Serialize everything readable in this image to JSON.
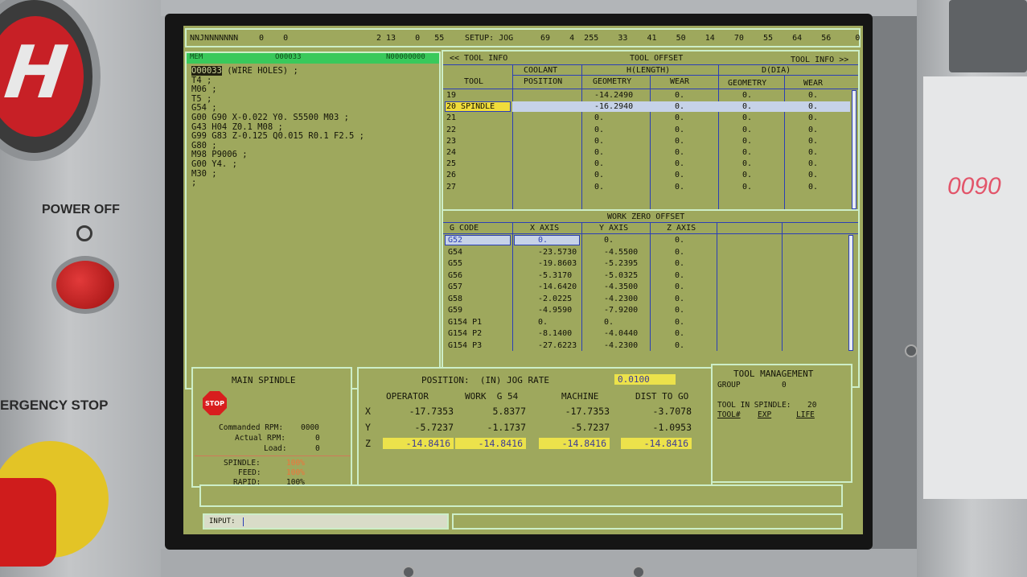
{
  "machine": {
    "power_off_label": "POWER OFF",
    "estop_label": "ERGENCY STOP",
    "sticker_text": "0090"
  },
  "status_bar": {
    "program_code": "NNJNNNNNNN",
    "vals_left": "0    0",
    "vals_mid": "2 13    0   55",
    "setup_label": "SETUP: JOG",
    "vals_right": "69    4  255    33    41    50    14    70    55    64    56     0     0"
  },
  "program": {
    "head_left": "MEM",
    "head_mid": "O00033",
    "head_right": "N00000000",
    "lines": [
      "O00033 (WIRE HOLES) ;",
      "T4 ;",
      "M06 ;",
      "T5 ;",
      "G54 ;",
      "G00 G90 X-0.022 Y0. S5500 M03 ;",
      "G43 H04 Z0.1 M08 ;",
      "G99 G83 Z-0.125 Q0.015 R0.1 F2.5 ;",
      "G80 ;",
      "M98 P9006 ;",
      "G00 Y4. ;",
      "M30 ;",
      ";"
    ]
  },
  "tool_offset": {
    "nav_left": "<< TOOL INFO",
    "title": "TOOL OFFSET",
    "nav_right": "TOOL INFO >>",
    "col_coolant": "COOLANT",
    "col_position": "POSITION",
    "col_tool": "TOOL",
    "col_hlength": "H(LENGTH)",
    "col_ddia": "D(DIA)",
    "col_geometry": "GEOMETRY",
    "col_wear": "WEAR",
    "rows": [
      {
        "tool": "19",
        "h_geo": "-14.2490",
        "h_wear": "0.",
        "d_geo": "0.",
        "d_wear": "0."
      },
      {
        "tool": "20 SPINDLE",
        "h_geo": "-16.2940",
        "h_wear": "0.",
        "d_geo": "0.",
        "d_wear": "0."
      },
      {
        "tool": "21",
        "h_geo": "0.",
        "h_wear": "0.",
        "d_geo": "0.",
        "d_wear": "0."
      },
      {
        "tool": "22",
        "h_geo": "0.",
        "h_wear": "0.",
        "d_geo": "0.",
        "d_wear": "0."
      },
      {
        "tool": "23",
        "h_geo": "0.",
        "h_wear": "0.",
        "d_geo": "0.",
        "d_wear": "0."
      },
      {
        "tool": "24",
        "h_geo": "0.",
        "h_wear": "0.",
        "d_geo": "0.",
        "d_wear": "0."
      },
      {
        "tool": "25",
        "h_geo": "0.",
        "h_wear": "0.",
        "d_geo": "0.",
        "d_wear": "0."
      },
      {
        "tool": "26",
        "h_geo": "0.",
        "h_wear": "0.",
        "d_geo": "0.",
        "d_wear": "0."
      },
      {
        "tool": "27",
        "h_geo": "0.",
        "h_wear": "0.",
        "d_geo": "0.",
        "d_wear": "0."
      }
    ]
  },
  "work_zero": {
    "title": "WORK ZERO OFFSET",
    "col_gcode": "G CODE",
    "col_x": "X AXIS",
    "col_y": "Y AXIS",
    "col_z": "Z AXIS",
    "rows": [
      {
        "g": "G52",
        "x": "0.",
        "y": "0.",
        "z": "0."
      },
      {
        "g": "G54",
        "x": "-23.5730",
        "y": "-4.5500",
        "z": "0."
      },
      {
        "g": "G55",
        "x": "-19.8603",
        "y": "-5.2395",
        "z": "0."
      },
      {
        "g": "G56",
        "x": "-5.3170",
        "y": "-5.0325",
        "z": "0."
      },
      {
        "g": "G57",
        "x": "-14.6420",
        "y": "-4.3500",
        "z": "0."
      },
      {
        "g": "G58",
        "x": "-2.0225",
        "y": "-4.2300",
        "z": "0."
      },
      {
        "g": "G59",
        "x": "-4.9590",
        "y": "-7.9200",
        "z": "0."
      },
      {
        "g": "G154 P1",
        "x": "0.",
        "y": "0.",
        "z": "0."
      },
      {
        "g": "G154 P2",
        "x": "-8.1400",
        "y": "-4.0440",
        "z": "0."
      },
      {
        "g": "G154 P3",
        "x": "-27.6223",
        "y": "-4.2300",
        "z": "0."
      }
    ]
  },
  "spindle": {
    "title": "MAIN SPINDLE",
    "stop_label": "STOP",
    "commanded_label": "Commanded RPM:",
    "commanded_val": "0000",
    "actual_label": "Actual RPM:",
    "actual_val": "0",
    "load_label": "Load:",
    "load_val": "0",
    "spindle_label": "SPINDLE:",
    "spindle_val": "100%",
    "feed_label": "FEED:",
    "feed_val": "100%",
    "rapid_label": "RAPID:",
    "rapid_val": "100%"
  },
  "position": {
    "title": "POSITION:  (IN) JOG RATE",
    "jog_rate": "0.0100",
    "col_operator": "OPERATOR",
    "col_work": "WORK  G 54",
    "col_machine": "MACHINE",
    "col_dist": "DIST TO GO",
    "rows": [
      {
        "axis": "X",
        "operator": "-17.7353",
        "work": "5.8377",
        "machine": "-17.7353",
        "dist": "-3.7078"
      },
      {
        "axis": "Y",
        "operator": "-5.7237",
        "work": "-1.1737",
        "machine": "-5.7237",
        "dist": "-1.0953"
      },
      {
        "axis": "Z",
        "operator": "-14.8416",
        "work": "-14.8416",
        "machine": "-14.8416",
        "dist": "-14.8416"
      }
    ]
  },
  "tool_management": {
    "title": "TOOL MANAGEMENT",
    "group_label": "GROUP",
    "group_val": "0",
    "in_spindle_label": "TOOL IN SPINDLE:",
    "in_spindle_val": "20",
    "col_tool": "TOOL#",
    "col_exp": "EXP",
    "col_life": "LIFE"
  },
  "input": {
    "label": "INPUT:"
  }
}
